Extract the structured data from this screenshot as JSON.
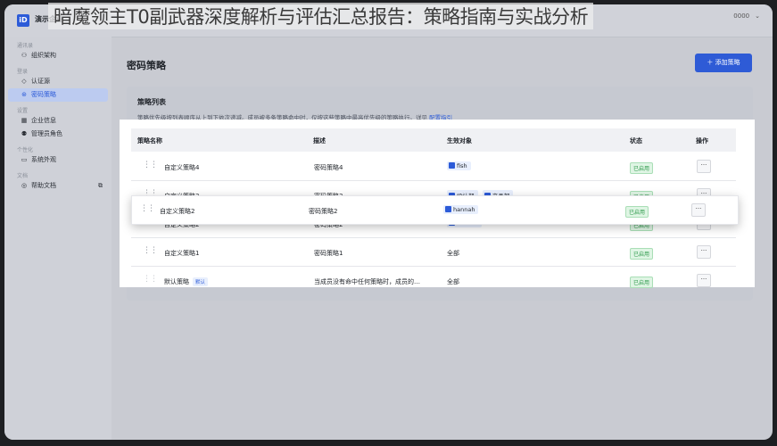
{
  "overlay_title": "暗魔领主T0副武器深度解析与评估汇总报告：策略指南与实战分析",
  "app": {
    "logo_text": "iD",
    "name": "演示企业"
  },
  "user": {
    "id": "0000"
  },
  "sidebar": {
    "groups": [
      {
        "label": "通讯录",
        "items": [
          {
            "label": "组织架构",
            "icon": "org-icon"
          }
        ]
      },
      {
        "label": "登录",
        "items": [
          {
            "label": "认证源",
            "icon": "auth-source-icon"
          },
          {
            "label": "密码策略",
            "icon": "password-policy-icon",
            "active": true
          }
        ]
      },
      {
        "label": "设置",
        "items": [
          {
            "label": "企业信息",
            "icon": "enterprise-icon"
          },
          {
            "label": "管理员角色",
            "icon": "admin-role-icon"
          }
        ]
      },
      {
        "label": "个性化",
        "items": [
          {
            "label": "系统外观",
            "icon": "monitor-icon"
          }
        ]
      },
      {
        "label": "文档",
        "items": [
          {
            "label": "帮助文档",
            "icon": "help-doc-icon",
            "external": true
          }
        ]
      }
    ]
  },
  "page": {
    "title": "密码策略",
    "add_button": "＋ 添加策略"
  },
  "card": {
    "title": "策略列表",
    "desc": "策略优先级按列表顺序从上到下依次递减。成员被多条策略命中时，仅按这些策略中最高优先级的策略执行。详见",
    "link": "配置指引"
  },
  "table": {
    "headers": {
      "name": "策略名称",
      "desc": "描述",
      "target": "生效对象",
      "status": "状态",
      "action": "操作"
    },
    "rows": [
      {
        "name": "自定义策略4",
        "desc": "密码策略4",
        "targets": [
          "fish"
        ],
        "status": "已启用"
      },
      {
        "name": "自定义策略3",
        "desc": "密码策略3",
        "targets": [
          "设计部",
          "产品部"
        ],
        "status": "已启用"
      },
      {
        "name": "自定义策略2",
        "desc": "密码策略2",
        "targets": [
          "hannah"
        ],
        "status": "已启用"
      },
      {
        "name": "自定义策略1",
        "desc": "密码策略1",
        "target_text": "全部",
        "status": "已启用"
      },
      {
        "name": "默认策略",
        "default_tag": "默认",
        "desc": "当成员没有命中任何策略时，成员的…",
        "target_text": "全部",
        "status": "已启用"
      }
    ],
    "dragging": {
      "name": "自定义策略2",
      "desc": "密码策略2",
      "target": "hannah",
      "status": "已启用"
    },
    "more_label": "···"
  }
}
